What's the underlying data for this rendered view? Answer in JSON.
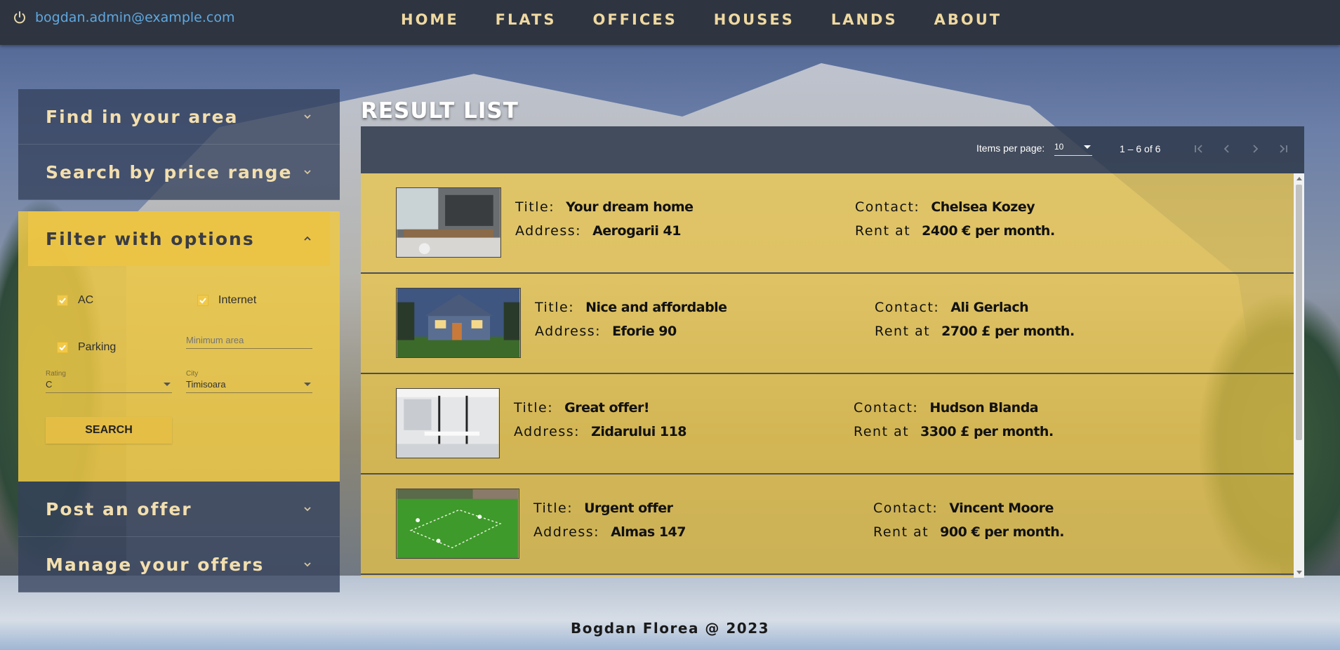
{
  "user": {
    "email": "bogdan.admin@example.com"
  },
  "nav": [
    "HOME",
    "FLATS",
    "OFFICES",
    "HOUSES",
    "LANDS",
    "ABOUT"
  ],
  "sidebar": {
    "find_area": "Find in your area",
    "price_range": "Search by price range",
    "filter_options": "Filter with options",
    "post_offer": "Post an offer",
    "manage_offers": "Manage your offers"
  },
  "filters": {
    "ac_label": "AC",
    "ac_checked": true,
    "internet_label": "Internet",
    "internet_checked": true,
    "parking_label": "Parking",
    "parking_checked": true,
    "min_area_placeholder": "Minimum area",
    "rating_label": "Rating",
    "rating_value": "C",
    "city_label": "City",
    "city_value": "Timisoara",
    "search_label": "SEARCH"
  },
  "results": {
    "title": "RESULT LIST",
    "items_per_page_label": "Items per page:",
    "items_per_page": "10",
    "range": "1 – 6 of 6",
    "title_key": "Title:",
    "address_key": "Address:",
    "contact_key": "Contact:",
    "rent_key": "Rent at",
    "items": [
      {
        "title": "Your dream home",
        "address": "Aerogarii 41",
        "contact": "Chelsea Kozey",
        "rent": "2400 € per month."
      },
      {
        "title": "Nice and affordable",
        "address": "Eforie 90",
        "contact": "Ali Gerlach",
        "rent": "2700 £ per month."
      },
      {
        "title": "Great offer!",
        "address": "Zidarului 118",
        "contact": "Hudson Blanda",
        "rent": "3300 £ per month."
      },
      {
        "title": "Urgent offer",
        "address": "Almas 147",
        "contact": "Vincent Moore",
        "rent": "900 € per month."
      }
    ]
  },
  "footer": "Bogdan Florea @ 2023",
  "colors": {
    "accent": "#eec846",
    "nav_text": "#f0d9a0",
    "topbar": "#2e3541"
  }
}
